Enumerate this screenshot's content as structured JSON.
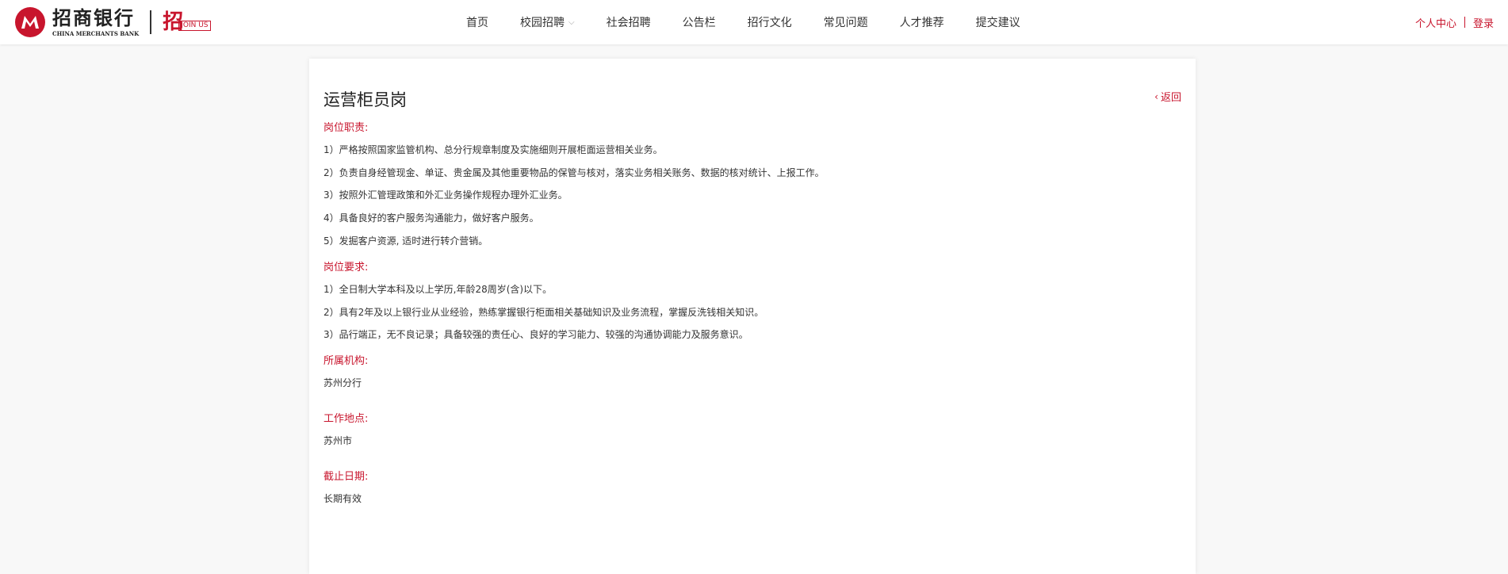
{
  "header": {
    "logo_cn": "招商银行",
    "logo_en": "CHINA MERCHANTS BANK",
    "joinus_zh": "招",
    "joinus_en": "JOIN US",
    "nav": [
      "首页",
      "校园招聘",
      "社会招聘",
      "公告栏",
      "招行文化",
      "常见问题",
      "人才推荐",
      "提交建议"
    ],
    "user_center": "个人中心",
    "login": "登录"
  },
  "job": {
    "title": "运营柜员岗",
    "back": "返回",
    "duties_label": "岗位职责:",
    "duties": [
      "1）严格按照国家监管机构、总分行规章制度及实施细则开展柜面运营相关业务。",
      "2）负责自身经管现金、单证、贵金属及其他重要物品的保管与核对，落实业务相关账务、数据的核对统计、上报工作。",
      "3）按照外汇管理政策和外汇业务操作规程办理外汇业务。",
      "4）具备良好的客户服务沟通能力，做好客户服务。",
      "5）发掘客户资源, 适时进行转介营销。"
    ],
    "requirements_label": "岗位要求:",
    "requirements": [
      "1）全日制大学本科及以上学历,年龄28周岁(含)以下。",
      "2）具有2年及以上银行业从业经验，熟练掌握银行柜面相关基础知识及业务流程，掌握反洗钱相关知识。",
      "3）品行端正，无不良记录；具备较强的责任心、良好的学习能力、较强的沟通协调能力及服务意识。"
    ],
    "org_label": "所属机构:",
    "org": "苏州分行",
    "location_label": "工作地点:",
    "location": "苏州市",
    "deadline_label": "截止日期:",
    "deadline": "长期有效"
  },
  "colors": {
    "brand": "#c8152d",
    "background": "#f8f8f8"
  }
}
